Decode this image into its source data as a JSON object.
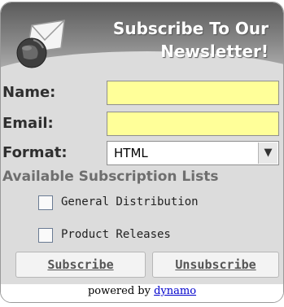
{
  "header": {
    "title_line1": "Subscribe To Our",
    "title_line2": "Newsletter!"
  },
  "form": {
    "name_label": "Name:",
    "name_value": "",
    "email_label": "Email:",
    "email_value": "",
    "format_label": "Format:",
    "format_selected": "HTML"
  },
  "lists": {
    "title": "Available Subscription Lists",
    "items": [
      {
        "label": "General Distribution",
        "checked": false
      },
      {
        "label": "Product Releases",
        "checked": false
      }
    ]
  },
  "buttons": {
    "subscribe_label": "Subscribe",
    "unsubscribe_label": "Unsubscribe"
  },
  "footer": {
    "powered_by": "powered by",
    "link_text": "dynamo"
  },
  "colors": {
    "field_bg": "#ffff99",
    "panel_bg": "#dcdcdc",
    "header_dark": "#5b5b5b"
  },
  "icons": {
    "logo": "globe-envelope-icon",
    "dropdown": "chevron-down-icon"
  }
}
